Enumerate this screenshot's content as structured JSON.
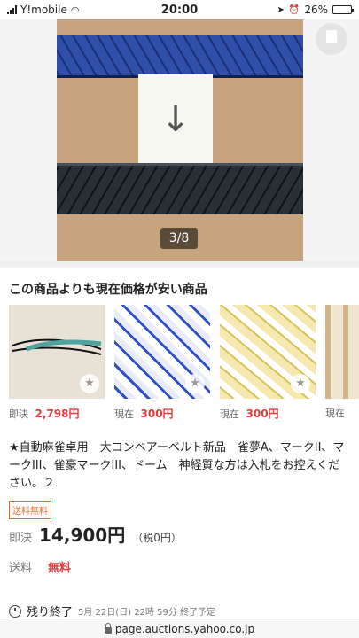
{
  "status": {
    "carrier": "Y!mobile",
    "time": "20:00",
    "battery": "26%",
    "battery_level": 0.26
  },
  "gallery": {
    "counter": "3/8"
  },
  "cheaper": {
    "heading": "この商品よりも現在価格が安い商品",
    "items": [
      {
        "label": "即決",
        "price": "2,798円"
      },
      {
        "label": "現在",
        "price": "300円"
      },
      {
        "label": "現在",
        "price": "300円"
      },
      {
        "label": "現在",
        "price": ""
      }
    ]
  },
  "listing": {
    "title": "★自動麻雀卓用　大コンベアーベルト新品　雀夢A、マークII、マークIII、雀豪マークIII、ドーム　神経質な方は入札をお控えください。２",
    "shipping_badge": "送料無料",
    "price_label": "即決",
    "price": "14,900円",
    "tax": "（税0円）",
    "shipping_label": "送料",
    "shipping_value": "無料",
    "end_label": "残り終了",
    "end_date": "5月 22日(日) 22時 59分 終了予定"
  },
  "browser": {
    "url": "page.auctions.yahoo.co.jp"
  },
  "icons": {
    "wifi": "wifi-icon",
    "location": "location-arrow-icon",
    "alarm": "alarm-icon",
    "star": "star-icon",
    "clock": "clock-icon",
    "lock": "lock-icon"
  },
  "colors": {
    "price_red": "#e43b3b",
    "badge_orange": "#e66a2c"
  }
}
